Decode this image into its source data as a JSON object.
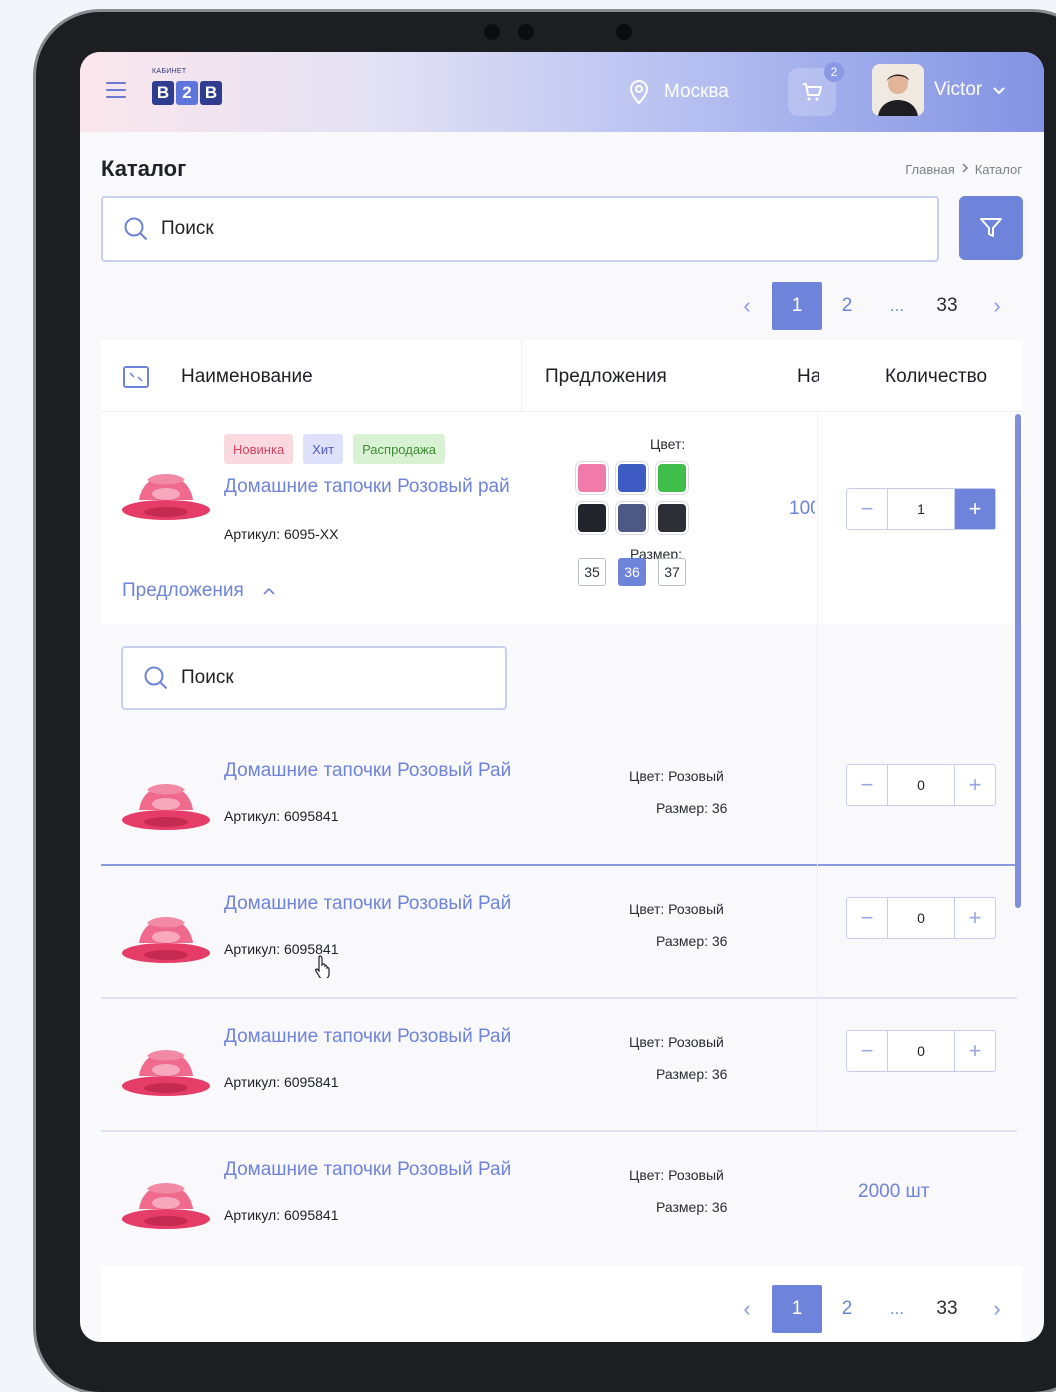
{
  "header": {
    "logo_small": "КАБИНЕТ",
    "logo_b2b_1": "B",
    "logo_b2b_2": "2",
    "logo_b2b_3": "B",
    "city": "Москва",
    "cart_count": "2",
    "user_name": "Victor"
  },
  "page": {
    "title": "Каталог",
    "breadcrumb": [
      "Главная",
      "Каталог"
    ]
  },
  "search": {
    "placeholder": "Поиск"
  },
  "pagination": {
    "pages": [
      "1",
      "2",
      "...",
      "33"
    ],
    "active": "1"
  },
  "table": {
    "columns": [
      "Наименование",
      "Предложения",
      "На",
      "Количество"
    ]
  },
  "product": {
    "tags": [
      "Новинка",
      "Хит",
      "Распродажа"
    ],
    "name": "Домашние тапочки Розовый рай",
    "sku": "Артикул: 6095-XX",
    "offers_toggle": "Предложения",
    "color_label": "Цвет:",
    "colors": [
      "#f07bab",
      "#3f5bc4",
      "#3fbf4a",
      "#22252c",
      "#4e5885",
      "#2c2f36"
    ],
    "size_label": "Размер:",
    "sizes": [
      "35",
      "36",
      "37"
    ],
    "active_size": "36",
    "price_cut": "100",
    "quantity": "1"
  },
  "sub_search": {
    "placeholder": "Поиск"
  },
  "offers": [
    {
      "name": "Домашние тапочки Розовый Рай",
      "sku": "Артикул: 6095841",
      "color": "Цвет: Розовый",
      "size": "Размер: 36",
      "quantity": "0"
    },
    {
      "name": "Домашние тапочки Розовый Рай",
      "sku": "Артикул: 6095841",
      "color": "Цвет: Розовый",
      "size": "Размер: 36",
      "quantity": "0"
    },
    {
      "name": "Домашние тапочки Розовый Рай",
      "sku": "Артикул: 6095841",
      "color": "Цвет: Розовый",
      "size": "Размер: 36",
      "quantity": "0"
    },
    {
      "name": "Домашние тапочки Розовый Рай",
      "sku": "Артикул: 6095841",
      "color": "Цвет: Розовый",
      "size": "Размер: 36",
      "stock": "2000 шт"
    }
  ],
  "colors": {
    "accent": "#6e83da",
    "text": "#1e1f26"
  }
}
